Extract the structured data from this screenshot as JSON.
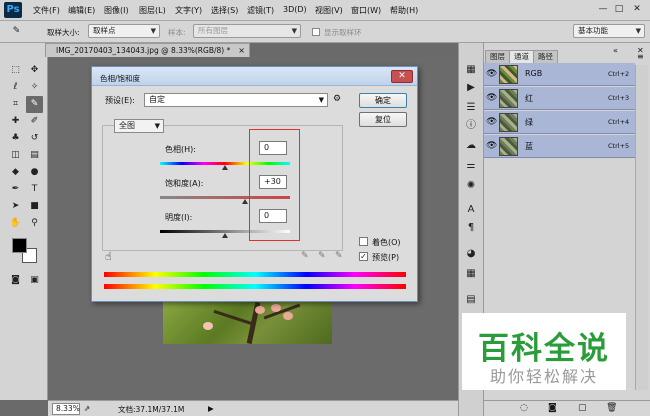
{
  "menubar": {
    "logo": "Ps",
    "items": [
      "文件(F)",
      "编辑(E)",
      "图像(I)",
      "图层(L)",
      "文字(Y)",
      "选择(S)",
      "滤镜(T)",
      "3D(D)",
      "视图(V)",
      "窗口(W)",
      "帮助(H)"
    ],
    "window_controls": [
      "—",
      "□",
      "✕"
    ]
  },
  "options": {
    "sample_size_label": "取样大小:",
    "sample_size_value": "取样点",
    "sample_label": "样本:",
    "sample_value": "所有图层",
    "show_ring_label": "显示取样环",
    "workspace": "基本功能"
  },
  "document": {
    "tab_title": "IMG_20170403_134043.jpg @ 8.33%(RGB/8) *",
    "close": "×"
  },
  "status": {
    "zoom": "8.33%",
    "doc_info": "文档:37.1M/37.1M"
  },
  "channels_panel": {
    "tabs": [
      "图层",
      "通道",
      "路径"
    ],
    "active_tab": "通道",
    "channels": [
      {
        "name": "RGB",
        "shortcut": "Ctrl+2"
      },
      {
        "name": "红",
        "shortcut": "Ctrl+3"
      },
      {
        "name": "绿",
        "shortcut": "Ctrl+4"
      },
      {
        "name": "蓝",
        "shortcut": "Ctrl+5"
      }
    ]
  },
  "dialog": {
    "title": "色相/饱和度",
    "preset_label": "预设(E):",
    "preset_value": "自定",
    "ok_label": "确定",
    "reset_label": "复位",
    "channel_value": "全图",
    "hue_label": "色相(H):",
    "hue_value": "0",
    "saturation_label": "饱和度(A):",
    "saturation_value": "+30",
    "lightness_label": "明度(I):",
    "lightness_value": "0",
    "colorize_label": "着色(O)",
    "colorize_checked": false,
    "preview_label": "预览(P)",
    "preview_checked": true
  },
  "watermark": {
    "main": "百科全说",
    "sub": "助你轻松解决"
  },
  "colors": {
    "accent_red": "#e03030",
    "selected_channel": "#a9b6d6",
    "watermark_green": "#2a9d3a"
  }
}
